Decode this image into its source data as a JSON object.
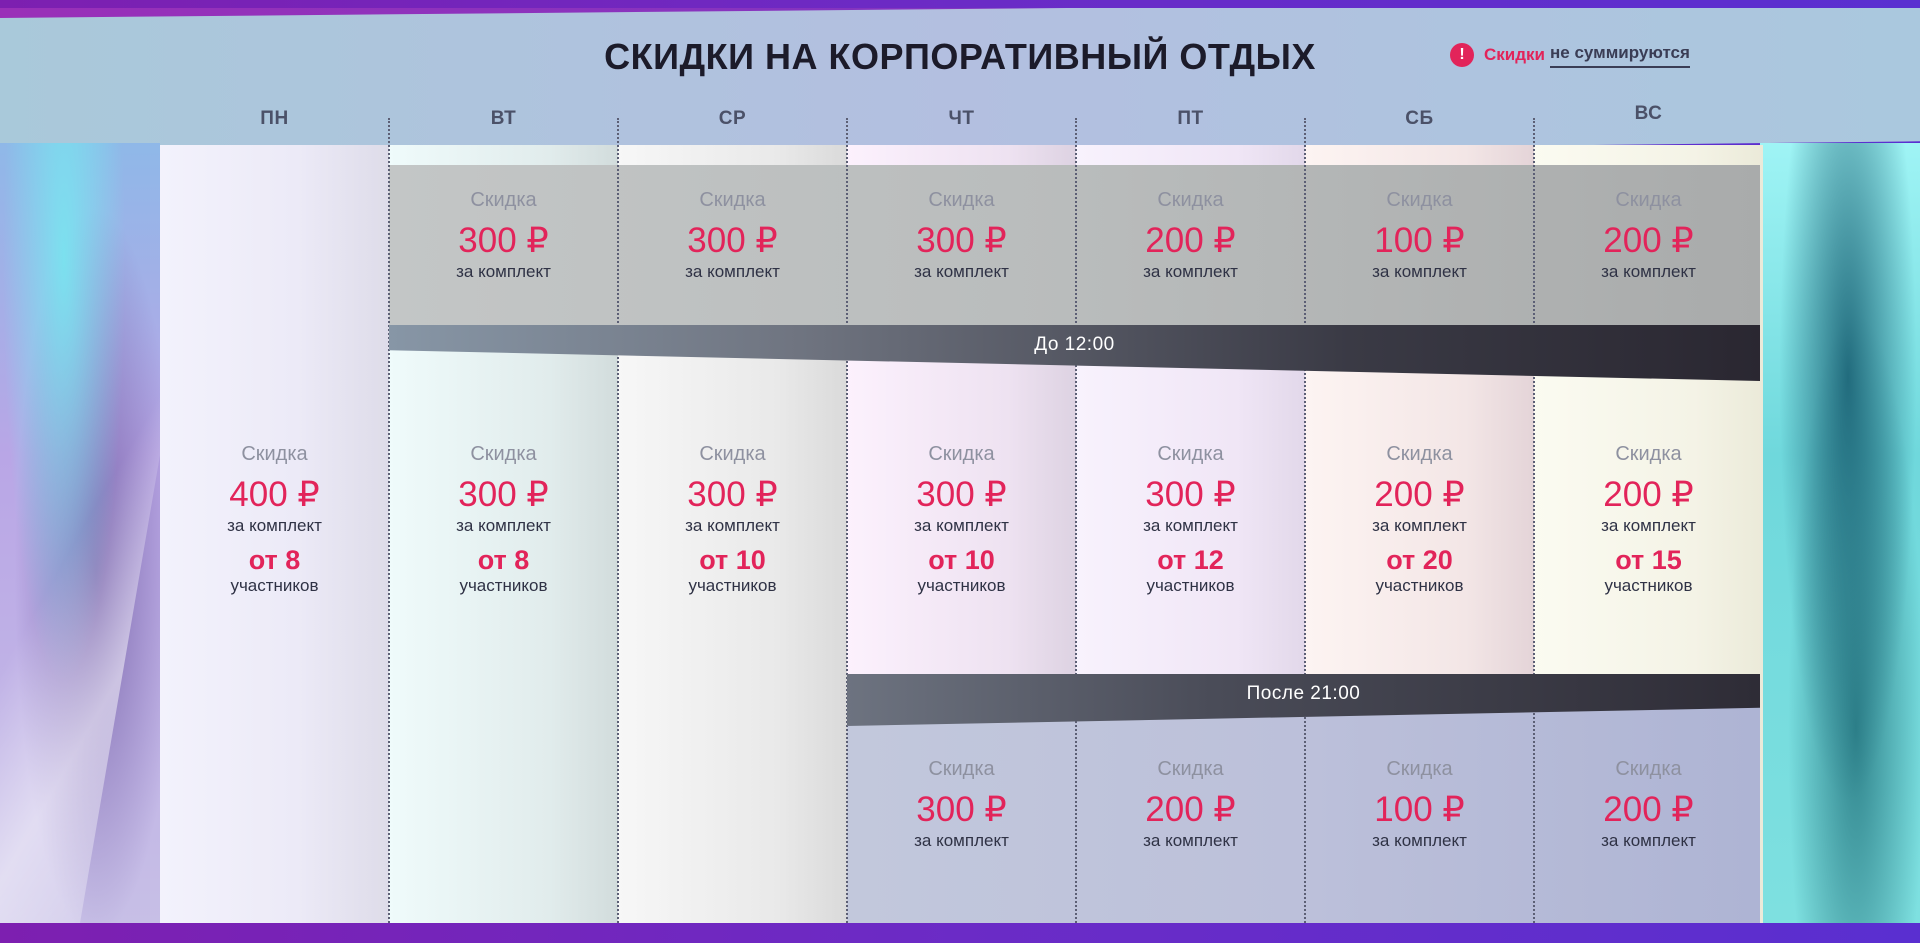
{
  "title": "СКИДКИ НА КОРПОРАТИВНЫЙ ОТДЫХ",
  "notice": {
    "part1": "Скидки",
    "part2": "не суммируются",
    "icon": "!"
  },
  "colors": {
    "accent": "#e2245a",
    "dark": "#2a2731",
    "header_bg": "#b3bfe0"
  },
  "days": [
    "ПН",
    "ВТ",
    "СР",
    "ЧТ",
    "ПТ",
    "СБ",
    "ВС"
  ],
  "bands": {
    "morning": "До 12:00",
    "evening": "После 21:00"
  },
  "morning": [
    null,
    {
      "label": "Скидка",
      "price": "300 ₽",
      "unit": "за комплект"
    },
    {
      "label": "Скидка",
      "price": "300 ₽",
      "unit": "за комплект"
    },
    {
      "label": "Скидка",
      "price": "300 ₽",
      "unit": "за комплект"
    },
    {
      "label": "Скидка",
      "price": "200 ₽",
      "unit": "за комплект"
    },
    {
      "label": "Скидка",
      "price": "100 ₽",
      "unit": "за комплект"
    },
    {
      "label": "Скидка",
      "price": "200 ₽",
      "unit": "за комплект"
    }
  ],
  "day": [
    {
      "label": "Скидка",
      "price": "400 ₽",
      "unit": "за комплект",
      "min": "от 8",
      "min_unit": "участников"
    },
    {
      "label": "Скидка",
      "price": "300 ₽",
      "unit": "за комплект",
      "min": "от 8",
      "min_unit": "участников"
    },
    {
      "label": "Скидка",
      "price": "300 ₽",
      "unit": "за комплект",
      "min": "от 10",
      "min_unit": "участников"
    },
    {
      "label": "Скидка",
      "price": "300 ₽",
      "unit": "за комплект",
      "min": "от 10",
      "min_unit": "участников"
    },
    {
      "label": "Скидка",
      "price": "300 ₽",
      "unit": "за комплект",
      "min": "от 12",
      "min_unit": "участников"
    },
    {
      "label": "Скидка",
      "price": "200 ₽",
      "unit": "за комплект",
      "min": "от 20",
      "min_unit": "участников"
    },
    {
      "label": "Скидка",
      "price": "200 ₽",
      "unit": "за комплект",
      "min": "от 15",
      "min_unit": "участников"
    }
  ],
  "evening": [
    null,
    null,
    null,
    {
      "label": "Скидка",
      "price": "300 ₽",
      "unit": "за комплект"
    },
    {
      "label": "Скидка",
      "price": "200 ₽",
      "unit": "за комплект"
    },
    {
      "label": "Скидка",
      "price": "100 ₽",
      "unit": "за комплект"
    },
    {
      "label": "Скидка",
      "price": "200 ₽",
      "unit": "за комплект"
    }
  ]
}
